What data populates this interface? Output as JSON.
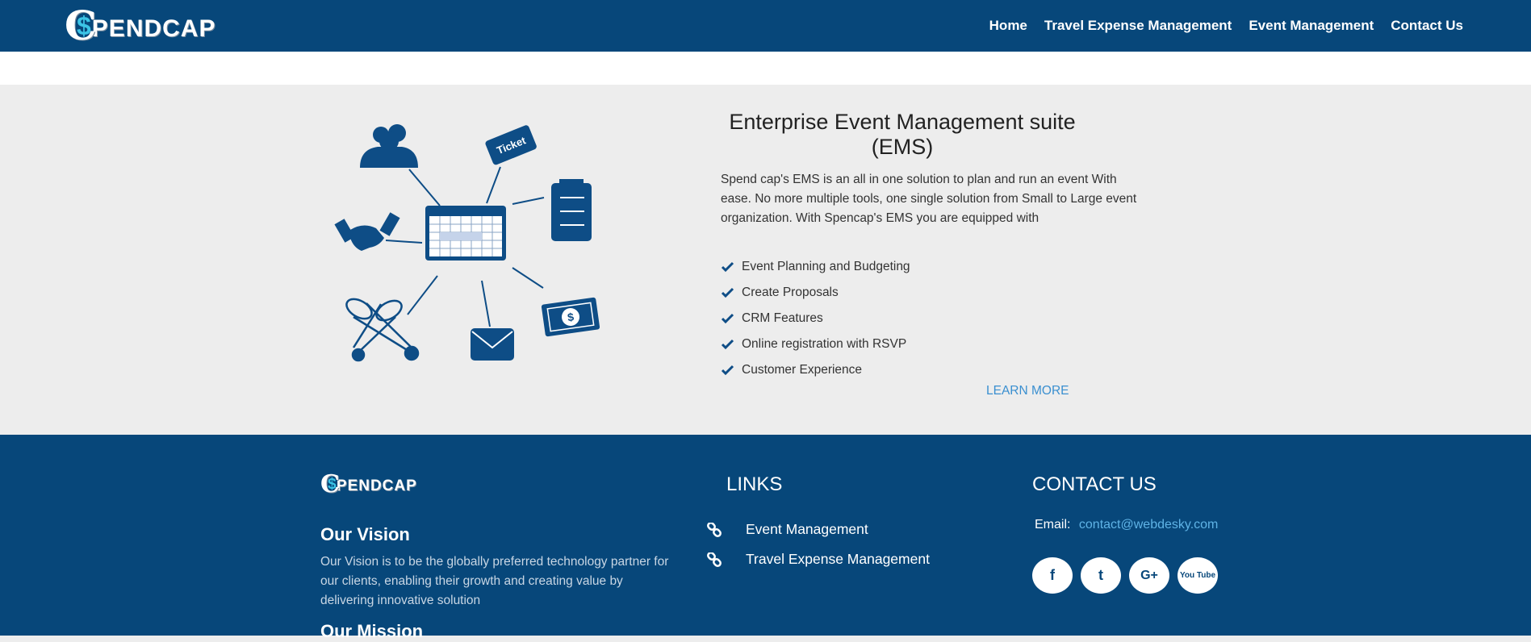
{
  "brand": {
    "logo_initial": "C",
    "logo_dollar": "$",
    "logo_word": "PENDCAP"
  },
  "nav": {
    "items": [
      {
        "label": "Home"
      },
      {
        "label": "Travel Expense Management"
      },
      {
        "label": "Event Management"
      },
      {
        "label": "Contact Us"
      }
    ]
  },
  "hero": {
    "title_line1": "Enterprise Event Management suite",
    "title_line2": "(EMS)",
    "description": "Spend cap's EMS is an all in one solution to plan and run an event With ease. No more multiple tools, one single solution from Small to Large event organization. With Spencap's EMS you are equipped with",
    "features": [
      "Event Planning and Budgeting",
      "Create Proposals",
      "CRM Features",
      "Online registration with RSVP",
      "Customer Experience"
    ],
    "learn_more": "LEARN MORE",
    "illustration": {
      "ticket_text": "Ticket",
      "money_symbol": "$"
    }
  },
  "footer": {
    "vision_title": "Our Vision",
    "vision_text": "Our Vision is to be the globally preferred technology partner for our clients, enabling their growth and creating value by delivering innovative solution",
    "mission_title": "Our Mission",
    "links_title": "LINKS",
    "links": [
      {
        "label": "Event Management"
      },
      {
        "label": "Travel Expense Management"
      }
    ],
    "contact_title": "CONTACT US",
    "email_label": "Email:",
    "email_value": "contact@webdesky.com",
    "socials": [
      {
        "icon": "facebook-icon",
        "glyph": "f"
      },
      {
        "icon": "twitter-icon",
        "glyph": "t"
      },
      {
        "icon": "google-plus-icon",
        "glyph": "G+"
      },
      {
        "icon": "youtube-icon",
        "glyph": "You Tube"
      }
    ]
  },
  "colors": {
    "navy": "#07477a",
    "accent_cyan": "#3cc4e6",
    "link_blue": "#3a8fd0",
    "hero_bg": "#ededed"
  }
}
